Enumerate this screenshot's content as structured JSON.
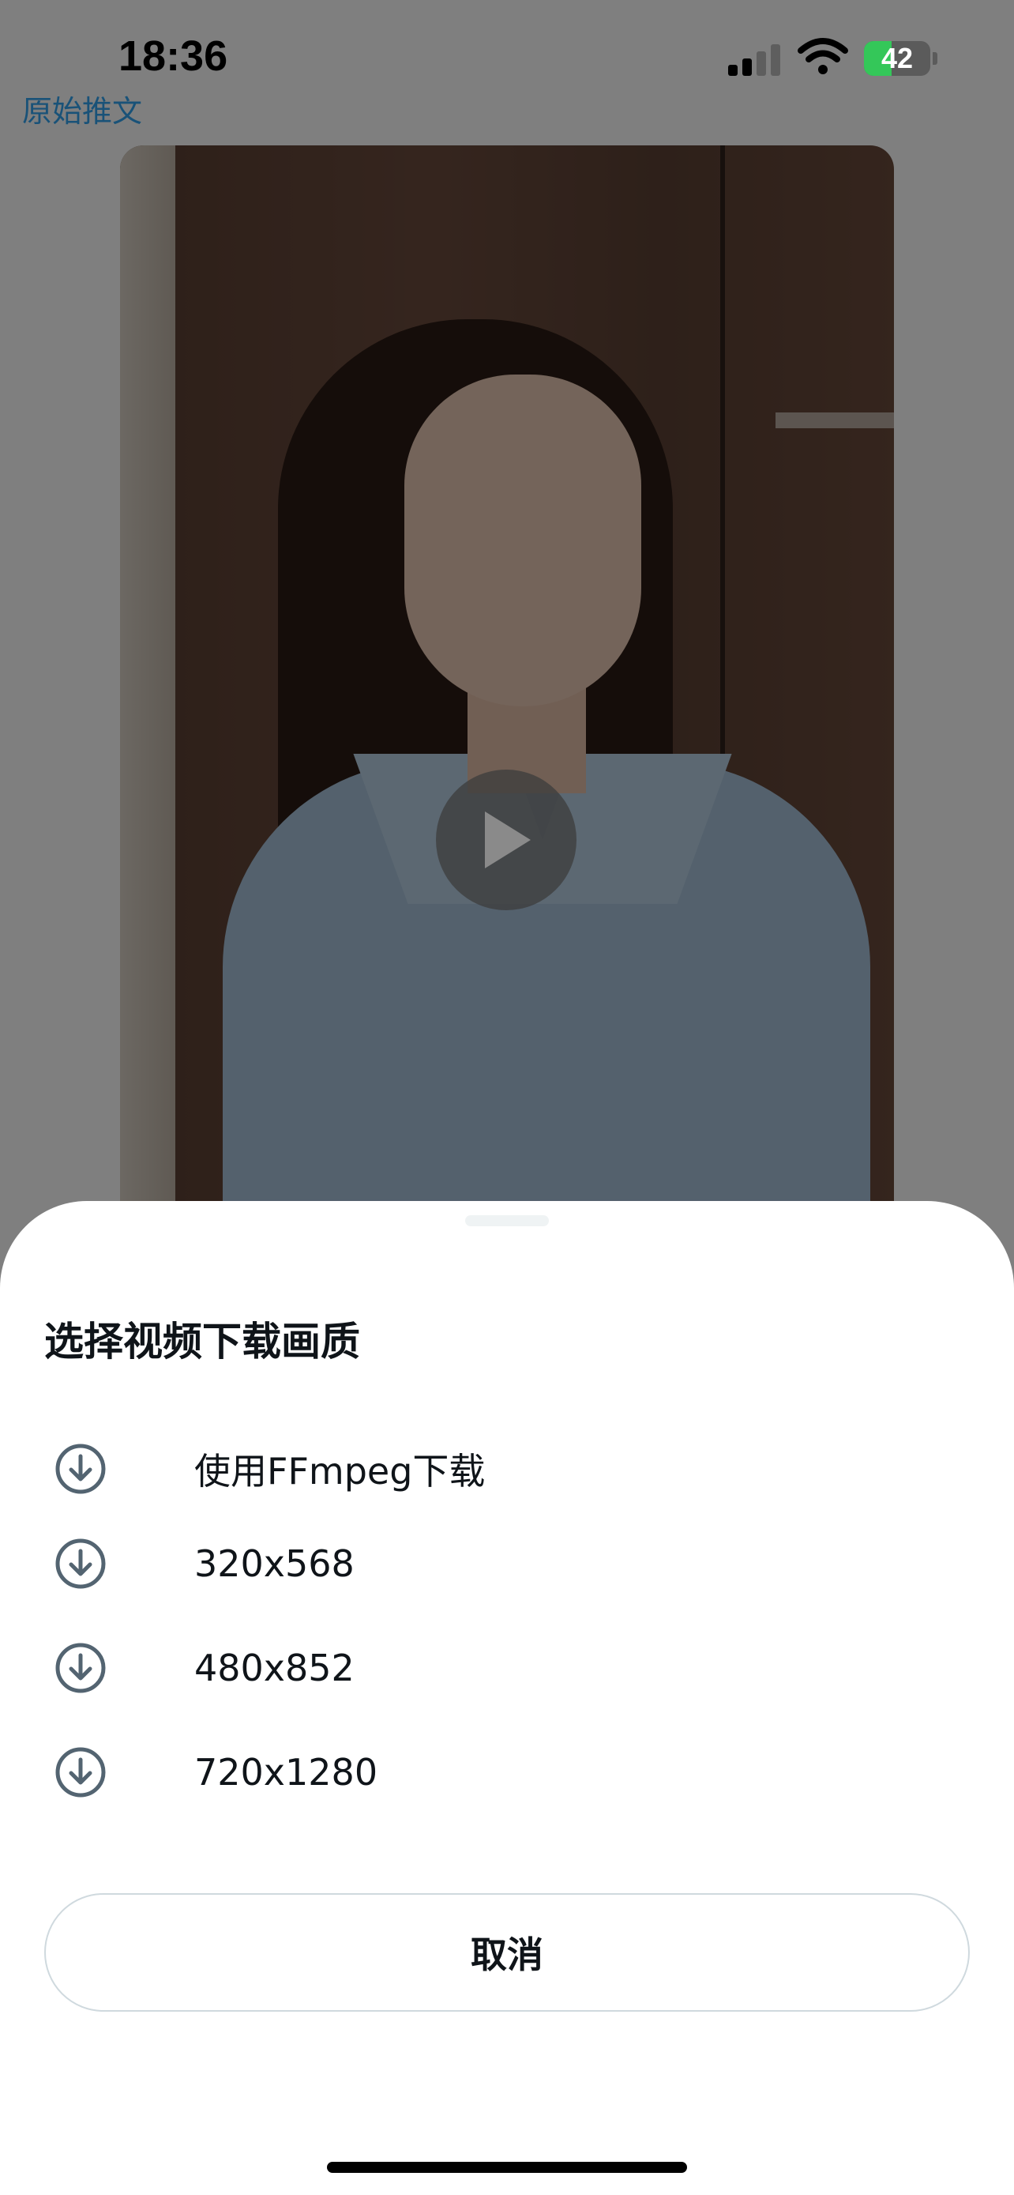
{
  "background": {
    "link_text": "原始推文"
  },
  "status_bar": {
    "time": "18:36",
    "battery_percent": 42,
    "battery_label": "42",
    "signal_bars_active": 2,
    "signal_bars_total": 4
  },
  "video": {
    "play_icon": "play-icon"
  },
  "sheet": {
    "title": "选择视频下载画质",
    "options": [
      {
        "label": "使用FFmpeg下载",
        "icon": "download-arrow-icon"
      },
      {
        "label": "320x568",
        "icon": "download-arrow-icon"
      },
      {
        "label": "480x852",
        "icon": "download-arrow-icon"
      },
      {
        "label": "720x1280",
        "icon": "download-arrow-icon"
      }
    ],
    "cancel_label": "取消"
  },
  "colors": {
    "text_primary": "#0f1419",
    "icon_stroke": "#536471",
    "border": "#cfd9de",
    "battery_green": "#34c759"
  }
}
